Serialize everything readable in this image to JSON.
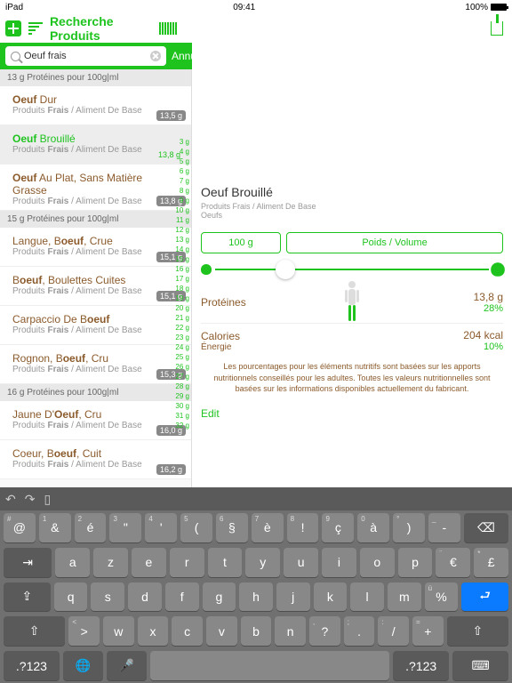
{
  "status": {
    "device": "iPad",
    "time": "09:41",
    "battery": "100%"
  },
  "topbar": {
    "title": "Recherche Produits"
  },
  "search": {
    "value": "Oeuf frais",
    "cancel": "Annuler"
  },
  "sections": [
    {
      "header": "13 g Protéines pour 100g|ml",
      "items": [
        {
          "pre": "",
          "bold": "Oeuf",
          "post": " Dur",
          "sub": "Produits Frais / Aliment De Base",
          "badge": "13,5 g"
        },
        {
          "pre": "",
          "bold": "Oeuf",
          "post": " Brouillé",
          "sub": "Produits Frais / Aliment De Base",
          "badge": "13,8 g",
          "selected": true
        },
        {
          "pre": "",
          "bold": "Oeuf",
          "post": " Au Plat, Sans Matière Grasse",
          "sub": "Produits Frais / Aliment De Base",
          "badge": "13,8 g"
        }
      ]
    },
    {
      "header": "15 g Protéines pour 100g|ml",
      "items": [
        {
          "pre": "Langue, B",
          "bold": "oeuf",
          "post": ", Crue",
          "sub": "Produits Frais / Aliment De Base",
          "badge": "15,1 g"
        },
        {
          "pre": "B",
          "bold": "oeuf",
          "post": ", Boulettes Cuites",
          "sub": "Produits Frais / Aliment De Base",
          "badge": "15,1 g"
        },
        {
          "pre": "Carpaccio De B",
          "bold": "oeuf",
          "post": "",
          "sub": "Produits Frais / Aliment De Base",
          "badge": ""
        },
        {
          "pre": "Rognon, B",
          "bold": "oeuf",
          "post": ", Cru",
          "sub": "Produits Frais / Aliment De Base",
          "badge": "15,3 g"
        }
      ]
    },
    {
      "header": "16 g Protéines pour 100g|ml",
      "items": [
        {
          "pre": "Jaune D'",
          "bold": "Oeuf",
          "post": ", Cru",
          "sub": "Produits Frais / Aliment De Base",
          "badge": "16,0 g"
        },
        {
          "pre": "Coeur, B",
          "bold": "oeuf",
          "post": ", Cuit",
          "sub": "Produits Frais / Aliment De Base",
          "badge": "16,2 g"
        }
      ]
    }
  ],
  "scale": [
    "3 g",
    "4 g",
    "5 g",
    "6 g",
    "7 g",
    "8 g",
    "9 g",
    "10 g",
    "11 g",
    "12 g",
    "13 g",
    "14 g",
    "15 g",
    "16 g",
    "17 g",
    "18 g",
    "19 g",
    "20 g",
    "21 g",
    "22 g",
    "23 g",
    "24 g",
    "25 g",
    "26 g",
    "27 g",
    "28 g",
    "29 g",
    "30 g",
    "31 g",
    "32 g"
  ],
  "detail": {
    "title": "Oeuf Brouillé",
    "sub1": "Produits Frais / Aliment De Base",
    "sub2": "Oeufs",
    "amount": "100 g",
    "weight_label": "Poids / Volume",
    "nutrients": [
      {
        "label": "Protéines",
        "value": "13,8 g",
        "pct": "28%"
      },
      {
        "label": "Calories",
        "sublabel": "Énergie",
        "value": "204 kcal",
        "pct": "10%"
      }
    ],
    "disclaimer": "Les pourcentages pour les éléments nutritifs sont basées sur les apports nutritionnels conseillés pour les adultes.\nToutes les valeurs nutritionnelles sont basées sur les informations disponibles actuellement du fabricant.",
    "edit": "Edit"
  },
  "keyboard": {
    "row1": [
      {
        "k": "@",
        "h": "#"
      },
      {
        "k": "&",
        "h": "1"
      },
      {
        "k": "é",
        "h": "2"
      },
      {
        "k": "\"",
        "h": "3"
      },
      {
        "k": "'",
        "h": "4"
      },
      {
        "k": "(",
        "h": "5"
      },
      {
        "k": "§",
        "h": "6"
      },
      {
        "k": "è",
        "h": "7"
      },
      {
        "k": "!",
        "h": "8"
      },
      {
        "k": "ç",
        "h": "9"
      },
      {
        "k": "à",
        "h": "0"
      },
      {
        "k": ")",
        "h": "°"
      },
      {
        "k": "-",
        "h": "_"
      }
    ],
    "row2": [
      "a",
      "z",
      "e",
      "r",
      "t",
      "y",
      "u",
      "i",
      "o",
      "p"
    ],
    "row2_end": [
      {
        "k": "€",
        "h": "¨"
      },
      {
        "k": "£",
        "h": "*"
      }
    ],
    "row3": [
      "q",
      "s",
      "d",
      "f",
      "g",
      "h",
      "j",
      "k",
      "l",
      "m"
    ],
    "row3_end": [
      {
        "k": "%",
        "h": "ù"
      }
    ],
    "row4": [
      "w",
      "x",
      "c",
      "v",
      "b",
      "n"
    ],
    "row4_pre": [
      {
        "k": ">",
        "h": "<"
      }
    ],
    "row4_end": [
      {
        "k": "?",
        "h": ","
      },
      {
        "k": ".",
        "h": ";"
      },
      {
        "k": "/",
        "h": ":"
      },
      {
        "k": "+",
        "h": "="
      }
    ],
    "numkey": ".?123"
  }
}
